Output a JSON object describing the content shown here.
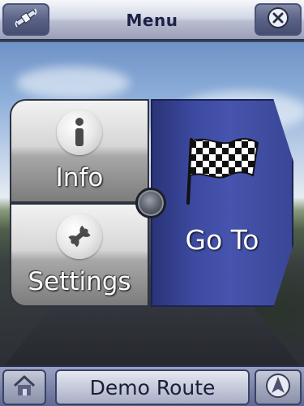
{
  "header": {
    "title": "Menu",
    "left_icon": "satellite-icon",
    "right_icon": "close-icon"
  },
  "menu": {
    "info": {
      "label": "Info",
      "icon": "info-icon"
    },
    "settings": {
      "label": "Settings",
      "icon": "wrench-icon"
    },
    "goto": {
      "label": "Go To",
      "icon": "checkered-flag-icon"
    }
  },
  "footer": {
    "home_icon": "home-icon",
    "route_label": "Demo Route",
    "nav_icon": "compass-arrow-icon"
  },
  "colors": {
    "goto_blue": "#3c4aa0",
    "header_text": "#1d2248",
    "tile_gray": "#d6d6d6"
  }
}
